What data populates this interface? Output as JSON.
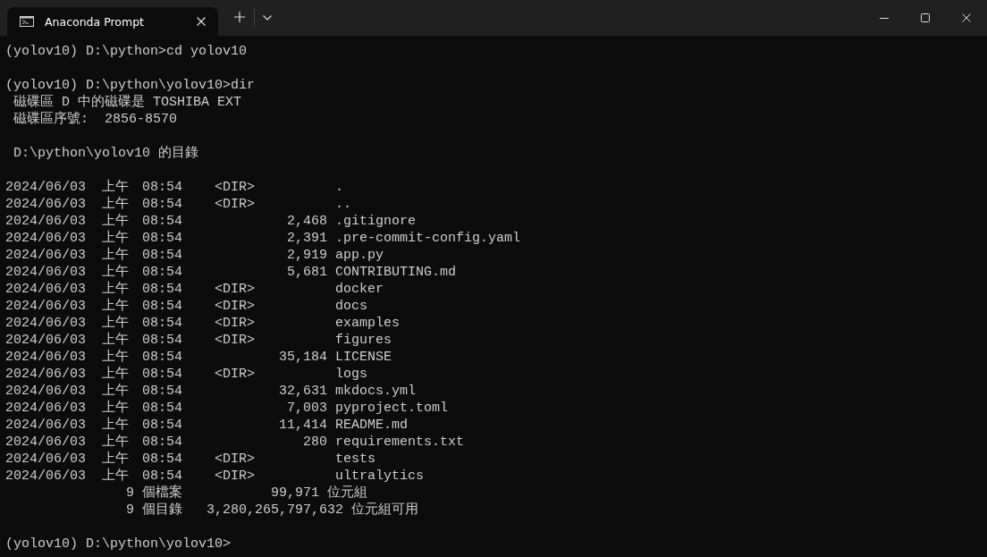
{
  "window": {
    "tab_title": "Anaconda Prompt"
  },
  "terminal": {
    "intro": [
      {
        "kind": "prompt",
        "text": "(yolov10) D:\\python>cd yolov10"
      },
      {
        "kind": "blank"
      },
      {
        "kind": "prompt",
        "text": "(yolov10) D:\\python\\yolov10>dir"
      },
      {
        "kind": "info",
        "text": "磁碟區 D 中的磁碟是 TOSHIBA EXT"
      },
      {
        "kind": "info",
        "text": "磁碟區序號:  2856-8570"
      },
      {
        "kind": "blank"
      },
      {
        "kind": "info",
        "text": "D:\\python\\yolov10 的目錄"
      },
      {
        "kind": "blank"
      }
    ],
    "listing": [
      {
        "date": "2024/06/03",
        "period": "上午",
        "time": "08:54",
        "kind": "dir",
        "type": "<DIR>",
        "name": "."
      },
      {
        "date": "2024/06/03",
        "period": "上午",
        "time": "08:54",
        "kind": "dir",
        "type": "<DIR>",
        "name": ".."
      },
      {
        "date": "2024/06/03",
        "period": "上午",
        "time": "08:54",
        "kind": "file",
        "size": "2,468",
        "name": ".gitignore"
      },
      {
        "date": "2024/06/03",
        "period": "上午",
        "time": "08:54",
        "kind": "file",
        "size": "2,391",
        "name": ".pre-commit-config.yaml"
      },
      {
        "date": "2024/06/03",
        "period": "上午",
        "time": "08:54",
        "kind": "file",
        "size": "2,919",
        "name": "app.py"
      },
      {
        "date": "2024/06/03",
        "period": "上午",
        "time": "08:54",
        "kind": "file",
        "size": "5,681",
        "name": "CONTRIBUTING.md"
      },
      {
        "date": "2024/06/03",
        "period": "上午",
        "time": "08:54",
        "kind": "dir",
        "type": "<DIR>",
        "name": "docker"
      },
      {
        "date": "2024/06/03",
        "period": "上午",
        "time": "08:54",
        "kind": "dir",
        "type": "<DIR>",
        "name": "docs"
      },
      {
        "date": "2024/06/03",
        "period": "上午",
        "time": "08:54",
        "kind": "dir",
        "type": "<DIR>",
        "name": "examples"
      },
      {
        "date": "2024/06/03",
        "period": "上午",
        "time": "08:54",
        "kind": "dir",
        "type": "<DIR>",
        "name": "figures"
      },
      {
        "date": "2024/06/03",
        "period": "上午",
        "time": "08:54",
        "kind": "file",
        "size": "35,184",
        "name": "LICENSE"
      },
      {
        "date": "2024/06/03",
        "period": "上午",
        "time": "08:54",
        "kind": "dir",
        "type": "<DIR>",
        "name": "logs"
      },
      {
        "date": "2024/06/03",
        "period": "上午",
        "time": "08:54",
        "kind": "file",
        "size": "32,631",
        "name": "mkdocs.yml"
      },
      {
        "date": "2024/06/03",
        "period": "上午",
        "time": "08:54",
        "kind": "file",
        "size": "7,003",
        "name": "pyproject.toml"
      },
      {
        "date": "2024/06/03",
        "period": "上午",
        "time": "08:54",
        "kind": "file",
        "size": "11,414",
        "name": "README.md"
      },
      {
        "date": "2024/06/03",
        "period": "上午",
        "time": "08:54",
        "kind": "file",
        "size": "280",
        "name": "requirements.txt"
      },
      {
        "date": "2024/06/03",
        "period": "上午",
        "time": "08:54",
        "kind": "dir",
        "type": "<DIR>",
        "name": "tests"
      },
      {
        "date": "2024/06/03",
        "period": "上午",
        "time": "08:54",
        "kind": "dir",
        "type": "<DIR>",
        "name": "ultralytics"
      }
    ],
    "summary": [
      {
        "count": "9",
        "label": "個檔案",
        "bytes": "99,971",
        "unit": "位元組"
      },
      {
        "count": "9",
        "label": "個目錄",
        "bytes": "3,280,265,797,632",
        "unit": "位元組可用"
      }
    ],
    "prompt": "(yolov10) D:\\python\\yolov10>"
  }
}
